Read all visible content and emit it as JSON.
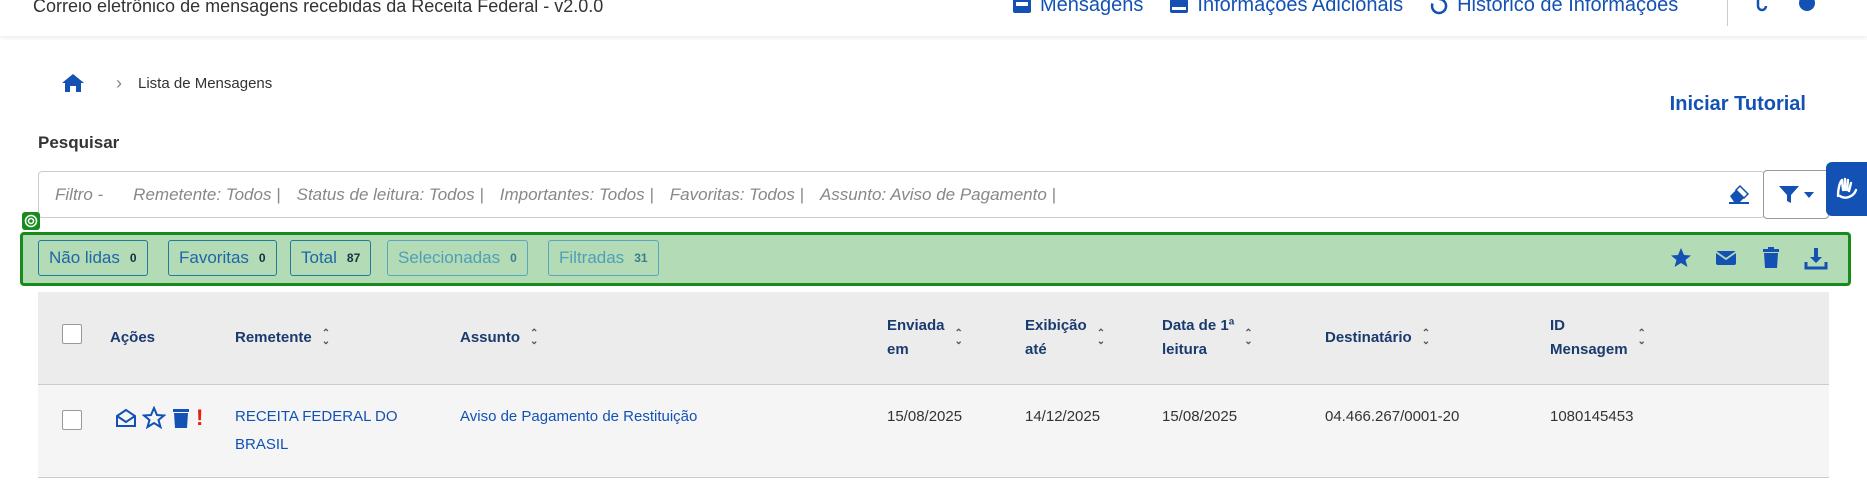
{
  "header": {
    "app_title": "Correio eletrônico de mensagens recebidas da Receita Federal - v2.0.0",
    "nav": [
      {
        "label": "Mensagens",
        "icon": "inbox-icon"
      },
      {
        "label": "Informações Adicionais",
        "icon": "id-card-icon"
      },
      {
        "label": "Histórico de Informações",
        "icon": "history-icon"
      }
    ],
    "right_icons": [
      "logout-icon",
      "help-icon"
    ]
  },
  "breadcrumb": {
    "home_icon": "home-icon",
    "current": "Lista de Mensagens"
  },
  "tutorial_link": "Iniciar Tutorial",
  "search": {
    "label": "Pesquisar",
    "filter_prefix": "Filtro -",
    "filters": [
      "Remetente: Todos |",
      "Status de leitura: Todos |",
      "Importantes: Todos |",
      "Favoritas: Todos |",
      "Assunto: Aviso de Pagamento |"
    ]
  },
  "counters": [
    {
      "label": "Não lidas",
      "count": "0"
    },
    {
      "label": "Favoritas",
      "count": "0"
    },
    {
      "label": "Total",
      "count": "87"
    },
    {
      "label": "Selecionadas",
      "count": "0"
    },
    {
      "label": "Filtradas",
      "count": "31"
    }
  ],
  "bar_actions": [
    "star-icon",
    "envelope-icon",
    "trash-icon",
    "download-icon"
  ],
  "table": {
    "headers": {
      "acoes": "Ações",
      "remetente": "Remetente",
      "assunto": "Assunto",
      "enviada_l1": "Enviada",
      "enviada_l2": "em",
      "exibicao_l1": "Exibição",
      "exibicao_l2": "até",
      "leitura_l1": "Data de 1ª",
      "leitura_l2": "leitura",
      "destinatario": "Destinatário",
      "id_l1": "ID",
      "id_l2": "Mensagem"
    },
    "rows": [
      {
        "remetente_l1": "RECEITA FEDERAL DO",
        "remetente_l2": "BRASIL",
        "assunto": "Aviso de Pagamento de Restituição",
        "enviada": "15/08/2025",
        "exibicao": "14/12/2025",
        "leitura": "15/08/2025",
        "destinatario": "04.466.267/0001-20",
        "id": "1080145453",
        "important_mark": "!"
      }
    ]
  },
  "colors": {
    "primary": "#1351b4",
    "highlight_fill": "#b3dbb5",
    "highlight_border": "#188b1e",
    "important": "#e52207"
  }
}
